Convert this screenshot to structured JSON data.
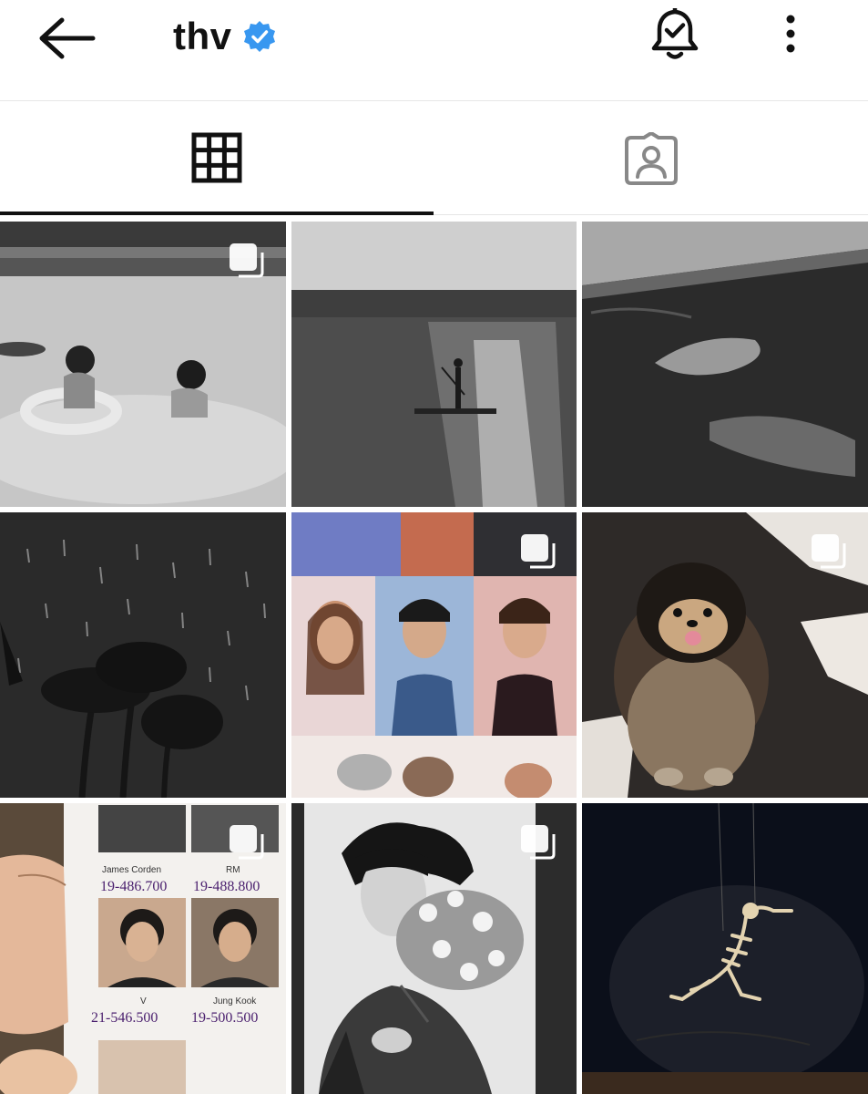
{
  "header": {
    "username": "thv",
    "verified": true,
    "icons": {
      "back": "arrow-left-icon",
      "verified": "verified-badge-icon",
      "notifications": "bell-check-icon",
      "more": "more-vertical-icon"
    }
  },
  "tabs": [
    {
      "name": "posts",
      "icon": "grid-icon",
      "active": true
    },
    {
      "name": "tagged",
      "icon": "person-tag-icon",
      "active": false
    }
  ],
  "posts": [
    {
      "scene": "black-and-white photo of two children in a pool, one with a swim ring",
      "multiple": true
    },
    {
      "scene": "black-and-white photo of a person paddleboarding on a lake with sun glare",
      "multiple": false
    },
    {
      "scene": "black-and-white photo of a pool edge with tiles and water",
      "multiple": false
    },
    {
      "scene": "black-and-white photo of palm trees in the rain at night",
      "multiple": false
    },
    {
      "scene": "collage of colorful photo-booth portraits",
      "multiple": true
    },
    {
      "scene": "fluffy Pomeranian dog sitting on a cowhide rug",
      "multiple": true
    },
    {
      "scene": "hand holding a sheet of headshots with names and numbers",
      "multiple": true,
      "labels": [
        "James Corden",
        "19-486.700",
        "RM",
        "19-488.800",
        "V",
        "21-546.500",
        "Jung Kook",
        "19-500.500"
      ]
    },
    {
      "scene": "black-and-white portrait of a man holding a bouquet of flowers",
      "multiple": true
    },
    {
      "scene": "dark room with a hanging bird skeleton sculpture",
      "multiple": false
    }
  ],
  "colors": {
    "verified_blue": "#3897f0",
    "text": "#111111",
    "divider": "#e6e6e6"
  }
}
